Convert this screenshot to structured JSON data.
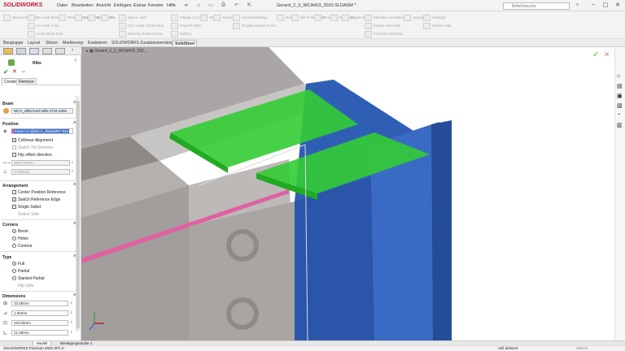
{
  "title_bar": {
    "logo": "SOLIDWORKS",
    "menus": [
      "Datei",
      "Bearbeiten",
      "Ansicht",
      "Einfügen",
      "Extras",
      "Fenster",
      "Hilfe"
    ],
    "document_title": "Gerard_2_3_WCA#03_2020.SLDASM *",
    "search_placeholder": "Befehlssuche"
  },
  "ribbon": {
    "groups": [
      {
        "label": "Beams\nBy Lines"
      },
      {
        "label": "Cut with Beam"
      },
      {
        "label": "Cut with Face"
      },
      {
        "label": "Cope Bead End"
      },
      {
        "label": "Remove\nCut"
      },
      {
        "label": "End\nPlate"
      },
      {
        "label": "Base\nPlate"
      },
      {
        "label": "Rib"
      },
      {
        "label": "Splice Joint"
      },
      {
        "label": "Clip Angle Connection"
      },
      {
        "label": "Bearing Gusset Plate"
      },
      {
        "label": "Flange Corner"
      },
      {
        "label": "Haunch Plate"
      },
      {
        "label": "Bolting"
      },
      {
        "label": "Stairs"
      },
      {
        "label": "Guard\nRail"
      },
      {
        "label": "Manual Bellings"
      },
      {
        "label": "Display Bolted Joints"
      },
      {
        "label": "Refresh"
      },
      {
        "label": "Bill of\nMaterials"
      },
      {
        "label": "Drawings"
      },
      {
        "label": "Wrk\nData"
      },
      {
        "label": "Export\nDSTV"
      },
      {
        "label": "Validate Annotation"
      },
      {
        "label": "Import Assembly"
      },
      {
        "label": "Position Assembly"
      },
      {
        "label": "Update"
      },
      {
        "label": "Settings"
      },
      {
        "label": "Online Help"
      }
    ]
  },
  "command_tabs": [
    "Baugruppe",
    "Layout",
    "Skizze",
    "Markierung",
    "Evaluieren",
    "SOLIDWORKS Zusatzanwendungen",
    "SolidSteel"
  ],
  "active_tab": "SolidSteel",
  "tree_item": "Gerard_2_3_WCA#03_202...",
  "property_manager": {
    "title": "Ribs",
    "tabs": [
      "Create",
      "Remove"
    ],
    "beam_section": {
      "heading": "Beam",
      "value": "WCA_df067e2d-2df6-4732-a39e"
    },
    "position_section": {
      "heading": "Position",
      "value": "Kante<1>@WCA_6bd4a897-b5e",
      "options": [
        {
          "label": "Collinear Alignment",
          "checked": true,
          "enabled": true
        },
        {
          "label": "Switch Tilt Direction",
          "checked": false,
          "enabled": false
        },
        {
          "label": "Flip offset direction",
          "checked": false,
          "enabled": true
        }
      ],
      "offset": "2500.00mm",
      "angle": "0.00Grad"
    },
    "arrangement_section": {
      "heading": "Arrangement",
      "options": [
        {
          "label": "Center Position Reference",
          "checked": false,
          "enabled": true
        },
        {
          "label": "Switch Reference Edge",
          "checked": true,
          "enabled": true
        },
        {
          "label": "Single Sided",
          "checked": false,
          "enabled": true
        },
        {
          "label": "Switch Side",
          "checked": false,
          "enabled": false
        }
      ]
    },
    "corners_section": {
      "heading": "Corners",
      "options": [
        "Bevel",
        "Holes",
        "Contour"
      ],
      "selected": "Bevel"
    },
    "type_section": {
      "heading": "Type",
      "options": [
        "Full",
        "Partial",
        "Slanted Partial"
      ],
      "selected": "Full",
      "extra_option": "Flip Side"
    },
    "dimensions_section": {
      "heading": "Dimensions",
      "values": [
        "10.00mm",
        "1.00mm",
        "110.00mm",
        "21.00mm"
      ]
    }
  },
  "bottom_tabs": [
    "Modell",
    "Bewegungsstudie 1"
  ],
  "status_bar": {
    "product": "SOLIDWORKS Premium 2020 SP1.0",
    "state": "Voll definiert",
    "units": "MMGS"
  },
  "colors": {
    "rib_green": "#33cc33",
    "beam_blue": "#2f5fb5",
    "plate_gray": "#aaa6a4",
    "accent_pink": "#e060a0"
  }
}
